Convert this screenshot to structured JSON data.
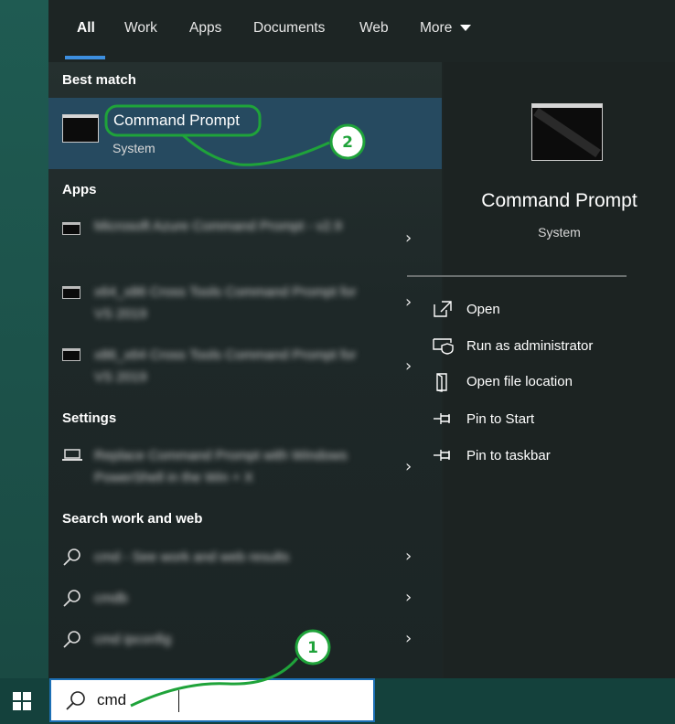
{
  "tabs": [
    "All",
    "Work",
    "Apps",
    "Documents",
    "Web",
    "More"
  ],
  "sections": {
    "best_match": "Best match",
    "apps": "Apps",
    "settings": "Settings",
    "search_web": "Search work and web"
  },
  "best_match": {
    "title": "Command Prompt",
    "subtitle": "System"
  },
  "apps_items": [
    "Microsoft Azure Command Prompt - v2.9",
    "x64_x86 Cross Tools Command Prompt for VS 2019",
    "x86_x64 Cross Tools Command Prompt for VS 2019"
  ],
  "settings_items": [
    "Replace Command Prompt with Windows PowerShell in the Win + X"
  ],
  "web_items": [
    "cmd - See work and web results",
    "cmdb",
    "cmd ipconfig"
  ],
  "detail": {
    "title": "Command Prompt",
    "subtitle": "System",
    "actions": [
      "Open",
      "Run as administrator",
      "Open file location",
      "Pin to Start",
      "Pin to taskbar"
    ]
  },
  "search": {
    "value": "cmd"
  },
  "annotations": {
    "badge1": "1",
    "badge2": "2"
  },
  "colors": {
    "accent": "#3d8fe0",
    "highlight": "#264a60",
    "annotation": "#1fa33a"
  }
}
